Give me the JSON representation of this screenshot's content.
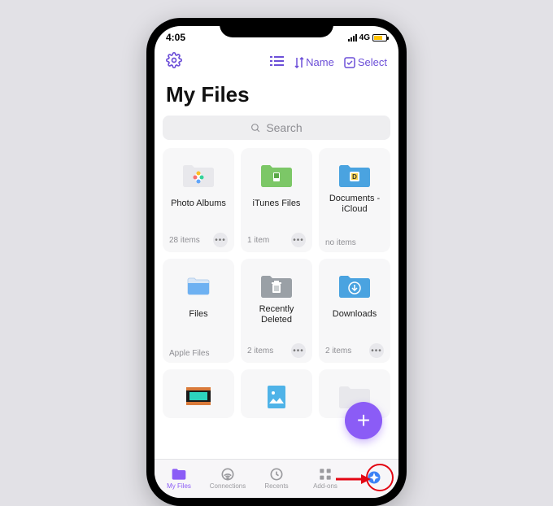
{
  "status": {
    "time": "4:05",
    "network": "4G"
  },
  "toolbar": {
    "view_label": "",
    "sort_label": "Name",
    "select_label": "Select"
  },
  "page": {
    "title": "My Files"
  },
  "search": {
    "placeholder": "Search"
  },
  "folders": [
    {
      "name": "Photo Albums",
      "meta": "28 items",
      "has_menu": true,
      "icon": "photos"
    },
    {
      "name": "iTunes Files",
      "meta": "1 item",
      "has_menu": true,
      "icon": "itunes"
    },
    {
      "name": "Documents - iCloud",
      "meta": "no items",
      "has_menu": false,
      "icon": "documents"
    },
    {
      "name": "Files",
      "meta": "Apple Files",
      "has_menu": false,
      "icon": "files"
    },
    {
      "name": "Recently Deleted",
      "meta": "2 items",
      "has_menu": true,
      "icon": "trash"
    },
    {
      "name": "Downloads",
      "meta": "2 items",
      "has_menu": true,
      "icon": "downloads"
    }
  ],
  "tabs": [
    {
      "label": "My Files",
      "icon": "folder",
      "active": true
    },
    {
      "label": "Connections",
      "icon": "wifi",
      "active": false
    },
    {
      "label": "Recents",
      "icon": "clock",
      "active": false
    },
    {
      "label": "Add-ons",
      "icon": "grid",
      "active": false
    },
    {
      "label": "",
      "icon": "compass",
      "active": false
    }
  ],
  "colors": {
    "accent": "#8b5cf6",
    "callout": "#e30613"
  }
}
